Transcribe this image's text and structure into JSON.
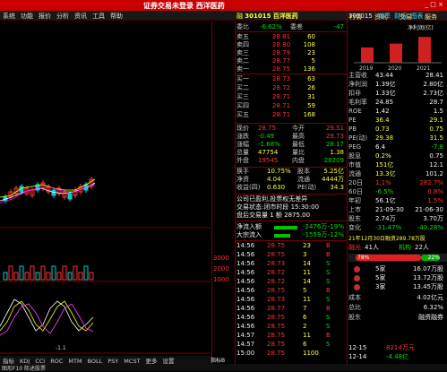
{
  "window": {
    "title": "证券交易未登录 西洋医药",
    "controls": [
      "_",
      "□",
      "×"
    ]
  },
  "menu": {
    "left": [
      "系统",
      "功能",
      "报价",
      "分析",
      "资讯",
      "工具",
      "帮助"
    ],
    "right": [
      "行情",
      "资讯",
      "交易",
      "服务"
    ]
  },
  "stock": {
    "code": "301015",
    "name": "百洋医药",
    "icon_label": "融"
  },
  "order_book": {
    "committee": {
      "label": "委比",
      "value": "-6.62%",
      "diff_label": "委差",
      "diff": "-47"
    },
    "sells": [
      {
        "label": "卖五",
        "price": "28.81",
        "vol": "60"
      },
      {
        "label": "卖四",
        "price": "28.80",
        "vol": "108"
      },
      {
        "label": "卖三",
        "price": "28.79",
        "vol": "23"
      },
      {
        "label": "卖二",
        "price": "28.77",
        "vol": "5"
      },
      {
        "label": "卖一",
        "price": "28.75",
        "vol": "136"
      }
    ],
    "buys": [
      {
        "label": "买一",
        "price": "28.73",
        "vol": "63"
      },
      {
        "label": "买二",
        "price": "28.72",
        "vol": "26"
      },
      {
        "label": "买三",
        "price": "28.71",
        "vol": "31"
      },
      {
        "label": "买四",
        "price": "28.71",
        "vol": "59"
      },
      {
        "label": "买五",
        "price": "28.71",
        "vol": "168"
      }
    ]
  },
  "quote": [
    {
      "l1": "现价",
      "v1": "28.75",
      "l2": "今开",
      "v2": "29.51"
    },
    {
      "l1": "涨跌",
      "v1": "-0.49",
      "l2": "最高",
      "v2": "29.73"
    },
    {
      "l1": "涨幅",
      "v1": "-1.68%",
      "l2": "最低",
      "v2": "28.17"
    },
    {
      "l1": "总量",
      "v1": "47754",
      "l2": "量比",
      "v2": "1.38"
    },
    {
      "l1": "外盘",
      "v1": "19545",
      "l2": "内盘",
      "v2": "28209"
    },
    {
      "l1": "换手",
      "v1": "10.75%",
      "l2": "股本",
      "v2": "5.25亿"
    },
    {
      "l1": "净资",
      "v1": "4.04",
      "l2": "流通",
      "v2": "4444万"
    },
    {
      "l1": "收益(四)",
      "v1": "0.630",
      "l2": "PE(动)",
      "v2": "34.3"
    }
  ],
  "notice": [
    "公司已盈利,投票权无差异",
    "交易状态:闭市时段 15:30:00",
    "盘后交易量 1 额 2875.00"
  ],
  "flows": [
    {
      "label": "净流入额",
      "value": "-2476万",
      "pct": "-19%"
    },
    {
      "label": "大宗流入",
      "value": "-1559万",
      "pct": "-12%"
    }
  ],
  "ticks": [
    {
      "t": "14:56",
      "p": "28.75",
      "v": "23",
      "f": "B"
    },
    {
      "t": "14:56",
      "p": "28.75",
      "v": "3",
      "f": "B"
    },
    {
      "t": "14:56",
      "p": "28.73",
      "v": "14",
      "f": "S"
    },
    {
      "t": "14:56",
      "p": "28.72",
      "v": "11",
      "f": "S"
    },
    {
      "t": "14:56",
      "p": "28.72",
      "v": "14",
      "f": "S"
    },
    {
      "t": "14:56",
      "p": "28.75",
      "v": "5",
      "f": "B"
    },
    {
      "t": "14:56",
      "p": "28.73",
      "v": "11",
      "f": "S"
    },
    {
      "t": "14:56",
      "p": "28.77",
      "v": "7",
      "f": "B"
    },
    {
      "t": "14:56",
      "p": "28.75",
      "v": "6",
      "f": "S"
    },
    {
      "t": "14:56",
      "p": "28.75",
      "v": "2",
      "f": "S"
    },
    {
      "t": "14:57",
      "p": "28.75",
      "v": "11",
      "f": "B"
    },
    {
      "t": "14:57",
      "p": "28.75",
      "v": "6",
      "f": "S"
    },
    {
      "t": "15:00",
      "p": "28.75",
      "v": "1100",
      "f": ""
    }
  ],
  "finance": {
    "header": {
      "code": "301015",
      "tabs": [
        "单季",
        "财报",
        "图表"
      ]
    },
    "bar_chart": {
      "title": "净利润(亿)",
      "categories": [
        "2019",
        "2020",
        "2021"
      ],
      "values": [
        1.6,
        2.0,
        2.7
      ]
    },
    "rows": [
      {
        "l": "主营收",
        "v1": "43.44",
        "v2": "28.41"
      },
      {
        "l": "净利润",
        "v1": "1.39亿",
        "v2": "2.80亿"
      },
      {
        "l": "扣非",
        "v1": "1.33亿",
        "v2": "2.73亿"
      },
      {
        "l": "毛利率",
        "v1": "24.85",
        "v2": "28.7"
      },
      {
        "l": "ROE",
        "v1": "1.42",
        "v2": "1.5"
      },
      {
        "l": "PE",
        "v1": "36.4",
        "v2": "29.1"
      },
      {
        "l": "PB",
        "v1": "0.73",
        "v2": "0.75"
      },
      {
        "l": "PE(动)",
        "v1": "29.38",
        "v2": "31.5"
      },
      {
        "l": "PEG",
        "v1": "6.4",
        "v2": "-7.8"
      },
      {
        "l": "股息",
        "v1": "0.2%",
        "v2": "0.75"
      },
      {
        "l": "市值",
        "v1": "151亿",
        "v2": "12.1"
      },
      {
        "l": "流通",
        "v1": "13.3亿",
        "v2": "101.2"
      },
      {
        "l": "20日",
        "v1": "1.1%",
        "v2": "282.7%"
      },
      {
        "l": "60日",
        "v1": "-6.5%",
        "v2": "0.8%"
      },
      {
        "l": "年初",
        "v1": "56.1亿",
        "v2": "1.5%"
      },
      {
        "l": "上市",
        "v1": "21-09-30",
        "v2": "21-06-30"
      },
      {
        "l": "股东",
        "v1": "2.74万",
        "v2": "3.70万"
      },
      {
        "l": "变化",
        "v1": "-31.47%",
        "v2": "-40.28%"
      }
    ],
    "volume_note": "21年12月30日融资289.78万股",
    "fund": {
      "l1": "融光",
      "v1": "41人",
      "l2": "机构",
      "v2": "22人",
      "bull": "78%",
      "bear": "22%"
    },
    "lhb": [
      {
        "d": "5家",
        "v": "16.07万股"
      },
      {
        "d": "5家",
        "v": "13.72万股"
      },
      {
        "d": "3家",
        "v": "13.45万股"
      }
    ],
    "extra": [
      {
        "l": "成本",
        "v": "4.02亿元"
      },
      {
        "l": "总比",
        "v": "6.32%"
      },
      {
        "l": "股东",
        "v": "融资融券"
      }
    ],
    "bottom": [
      {
        "d": "12-15",
        "v": "8214万元",
        "c": "red"
      },
      {
        "d": "12-14",
        "v": "-4.48亿",
        "c": "grn"
      }
    ]
  },
  "chart": {
    "price_ticks": [
      "3000",
      "2000",
      "1000"
    ],
    "x_ticks": [
      "-1.1"
    ],
    "tabs": [
      "指标",
      "KDJ",
      "CCI",
      "ROC",
      "MTM",
      "BOLL",
      "PSY",
      "MCST",
      "更多",
      "设置"
    ],
    "extra_tab": "指标B"
  },
  "footer": "图形F10 陈述股票"
}
